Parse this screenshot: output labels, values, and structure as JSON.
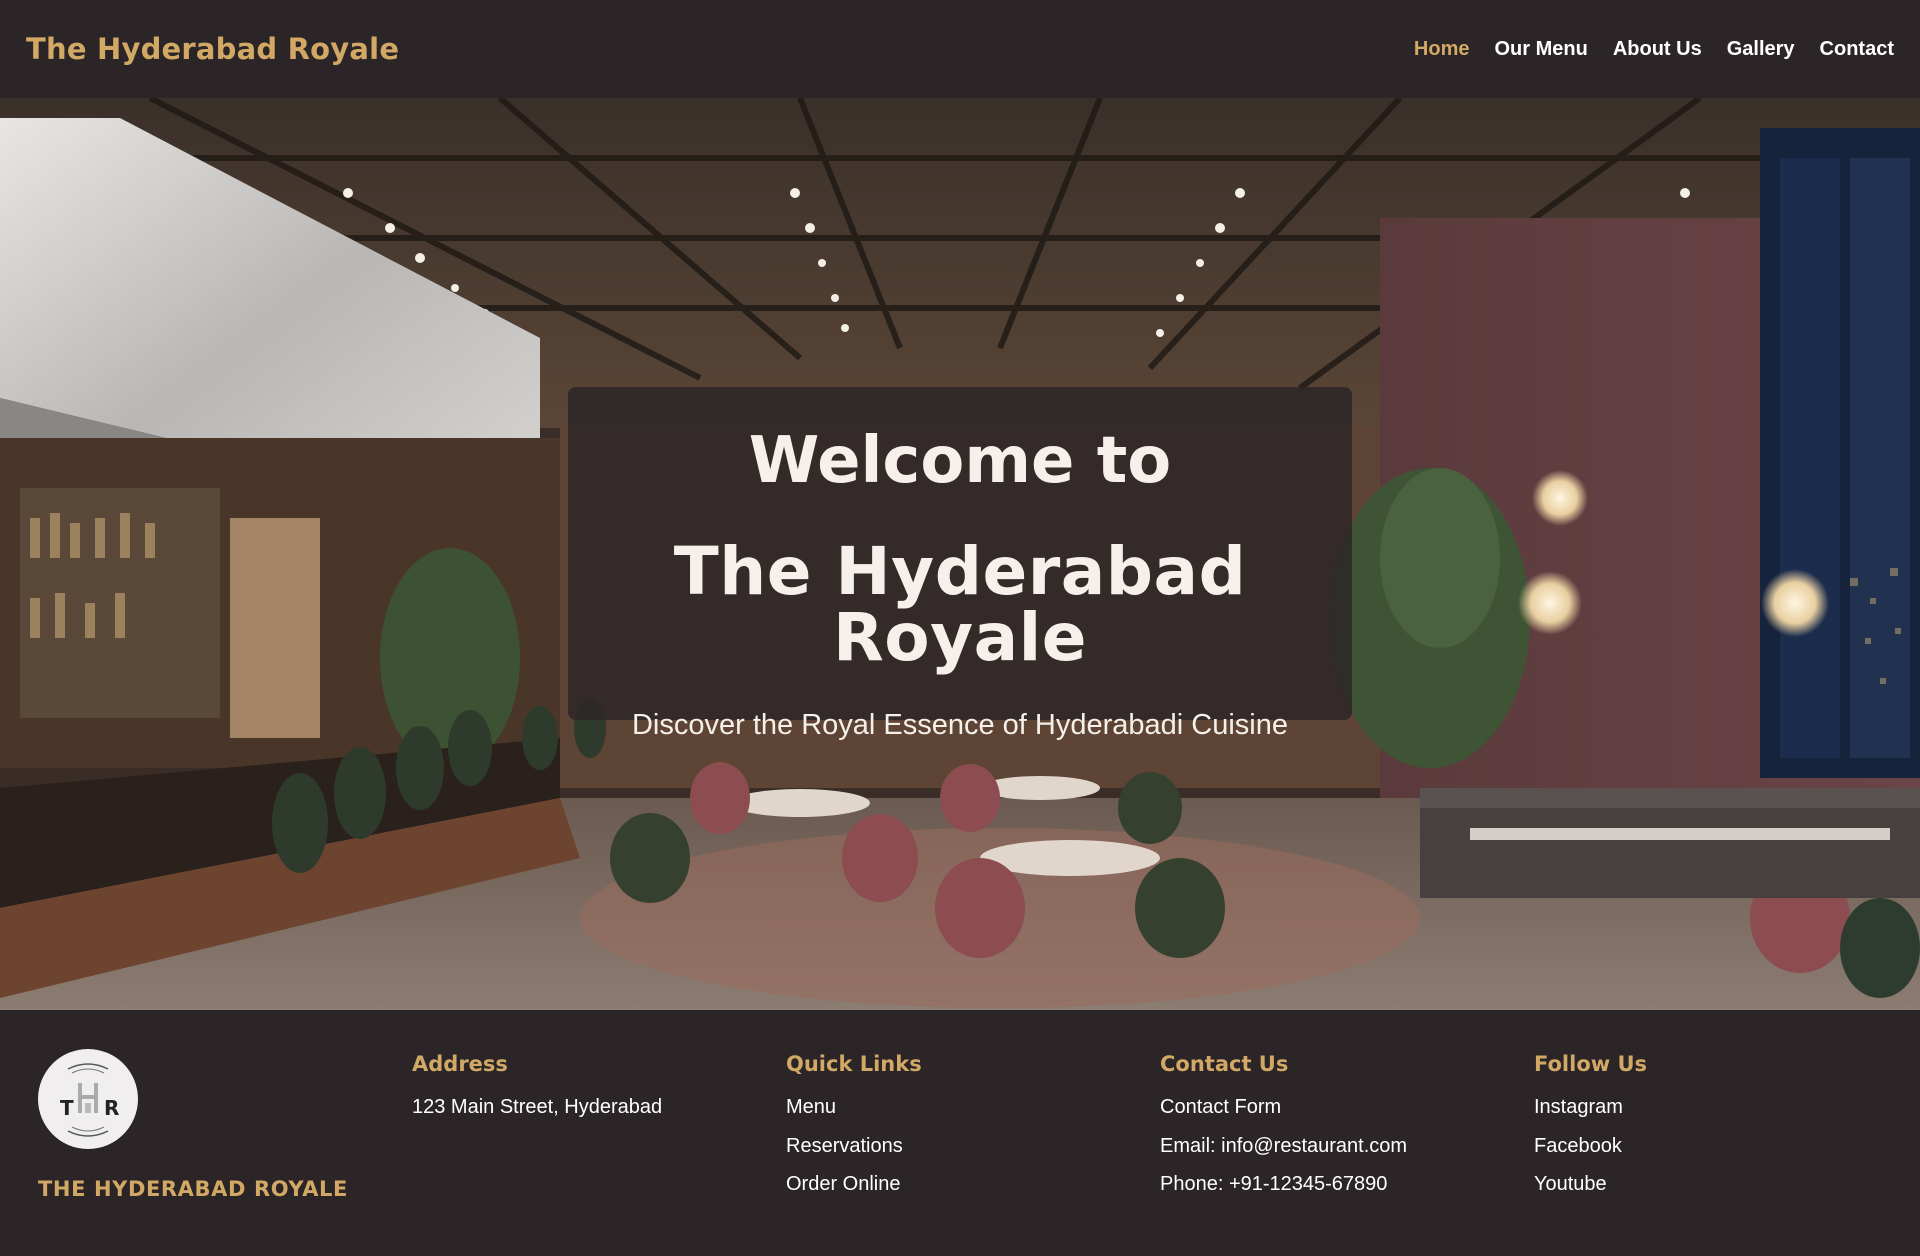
{
  "header": {
    "brand": "The Hyderabad Royale",
    "nav": [
      {
        "label": "Home",
        "active": true
      },
      {
        "label": "Our Menu"
      },
      {
        "label": "About Us"
      },
      {
        "label": "Gallery"
      },
      {
        "label": "Contact"
      }
    ]
  },
  "hero": {
    "title_line1": "Welcome to",
    "title_line2": "The Hyderabad Royale",
    "subtitle": "Discover the Royal Essence of Hyderabadi Cuisine"
  },
  "footer": {
    "logo_letters": [
      "T",
      "R"
    ],
    "logo_name": "THE HYDERABAD ROYALE",
    "address": {
      "heading": "Address",
      "lines": [
        "123 Main Street, Hyderabad"
      ]
    },
    "quick_links": {
      "heading": "Quick Links",
      "items": [
        "Menu",
        "Reservations",
        "Order Online"
      ]
    },
    "contact": {
      "heading": "Contact Us",
      "items": [
        "Contact Form",
        "Email: info@restaurant.com",
        "Phone: +91-12345-67890"
      ]
    },
    "follow": {
      "heading": "Follow Us",
      "items": [
        "Instagram",
        "Facebook",
        "Youtube"
      ]
    }
  },
  "colors": {
    "background": "#2b2528",
    "accent": "#d2a865",
    "text": "#ffffff"
  }
}
